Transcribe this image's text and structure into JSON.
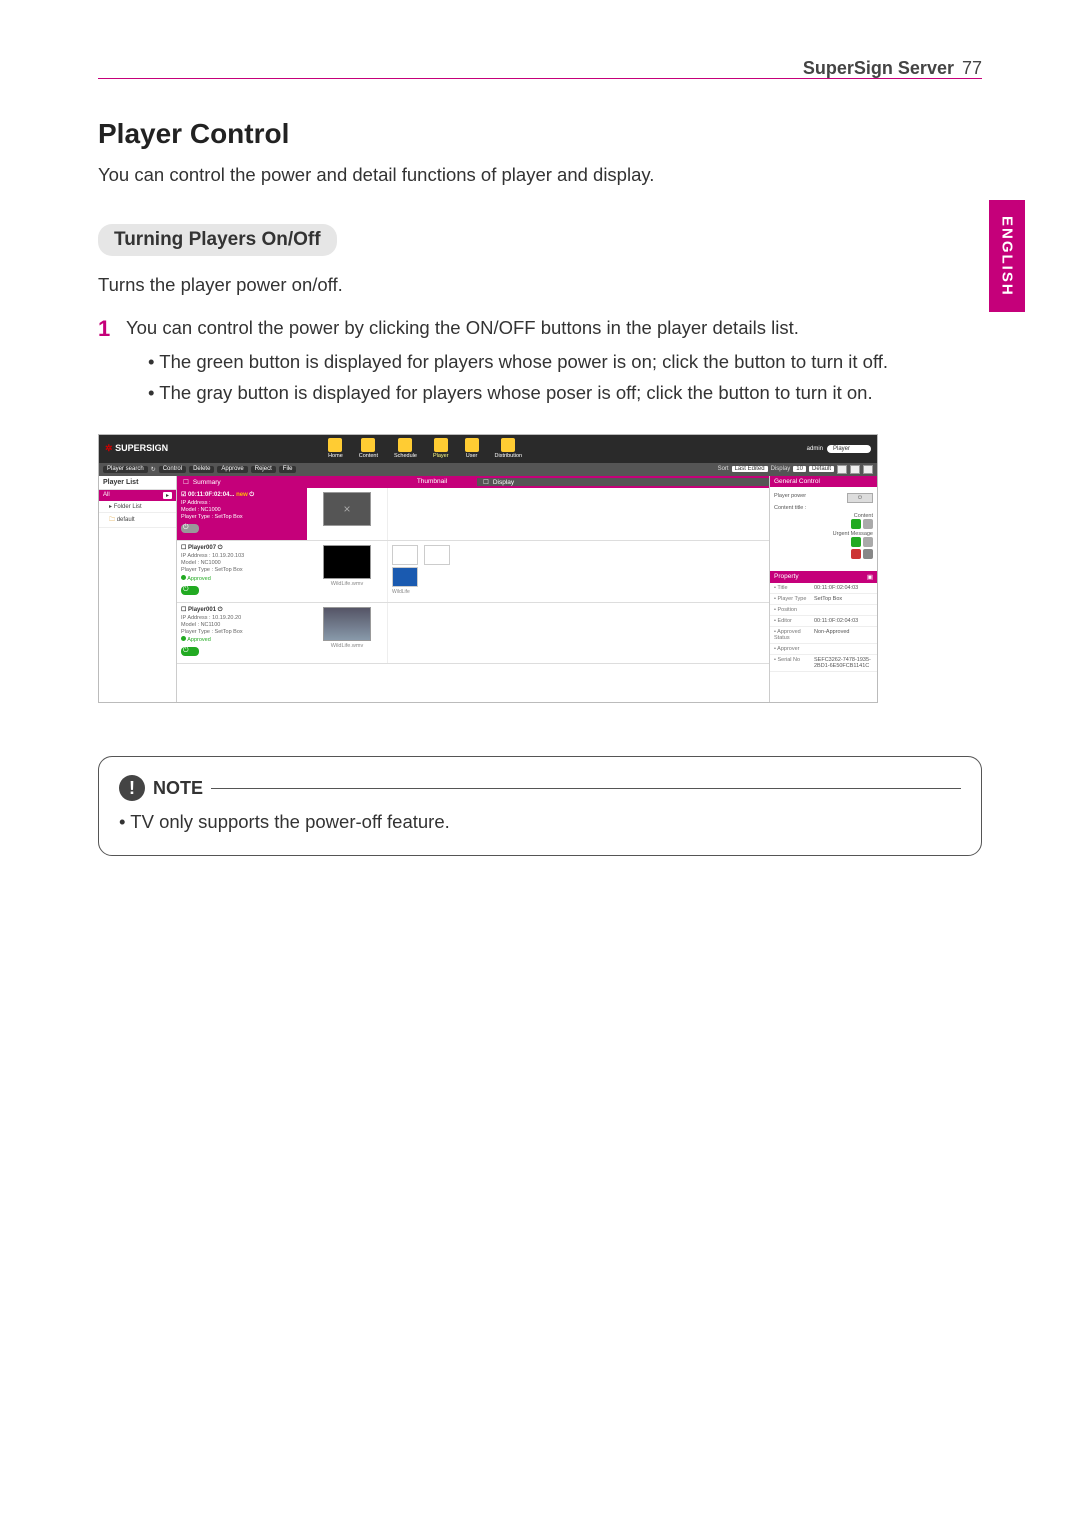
{
  "header": {
    "label": "SuperSign Server",
    "page": "77"
  },
  "lang_tab": "ENGLISH",
  "title": "Player Control",
  "intro": "You can control the power and detail functions of player and display.",
  "section": "Turning Players On/Off",
  "subtext": "Turns the player power on/off.",
  "step_num": "1",
  "step_text": "You can control the power by clicking the ON/OFF buttons in the player details list.",
  "bullet1": "The green button is displayed for players whose power is on; click the button to turn it off.",
  "bullet2": "The gray button is displayed for players whose poser is off; click the button to turn it on.",
  "note": {
    "label": "NOTE",
    "text": "TV only supports the power-off feature."
  },
  "screenshot": {
    "logo": "SUPERSIGN",
    "top_right": {
      "admin": "admin",
      "search_scope": "Player"
    },
    "nav": [
      {
        "label": "Home"
      },
      {
        "label": "Content"
      },
      {
        "label": "Schedule"
      },
      {
        "label": "Player"
      },
      {
        "label": "User"
      },
      {
        "label": "Distribution"
      }
    ],
    "toolbar": {
      "search": "Player search",
      "refresh": "↻",
      "btns": [
        "Control",
        "Delete",
        "Approve",
        "Reject",
        "File"
      ],
      "sort_label": "Sort",
      "sort_value": "Last Edited",
      "display_label": "Display",
      "display_count": "10",
      "default": "Default"
    },
    "sidebar": {
      "title": "Player List",
      "all": "All",
      "folder": "Folder List",
      "default_folder": "default"
    },
    "columns": {
      "summary": "Summary",
      "thumbnail": "Thumbnail",
      "display": "Display"
    },
    "players": [
      {
        "name": "00:11:0F:02:04...",
        "ip": "IP Address :",
        "model": "Model : NC1000",
        "type": "Player Type : SetTop Box",
        "thumb_label": "",
        "disp_label": ""
      },
      {
        "name": "Player007",
        "ip": "IP Address : 10.19.20.103",
        "model": "Model : NC1000",
        "type": "Player Type : SetTop Box",
        "approved": "Approved",
        "thumb_label": "WildLife.wmv",
        "disp_label": "WildLife"
      },
      {
        "name": "Player001",
        "ip": "IP Address : 10.19.20.20",
        "model": "Model : NC1100",
        "type": "Player Type : SetTop Box",
        "approved": "Approved",
        "thumb_label": "WildLife.wmv",
        "disp_label": ""
      }
    ],
    "right_panel": {
      "head1": "General Control",
      "pp": "Player power",
      "ct": "Content title :",
      "content_label": "Content",
      "um": "Urgent Message",
      "prop_head": "Property",
      "rows": [
        {
          "k": "Title",
          "v": "00:11:0F:02:04:03"
        },
        {
          "k": "Player Type",
          "v": "SetTop Box"
        },
        {
          "k": "Position",
          "v": ""
        },
        {
          "k": "Editor",
          "v": "00:11:0F:02:04:03"
        },
        {
          "k": "Approved Status",
          "v": "Non-Approved"
        },
        {
          "k": "Approver",
          "v": ""
        },
        {
          "k": "Serial No",
          "v": "SEFC3262-7478-1935-2BD1-6E50FCB1141C"
        }
      ]
    }
  }
}
